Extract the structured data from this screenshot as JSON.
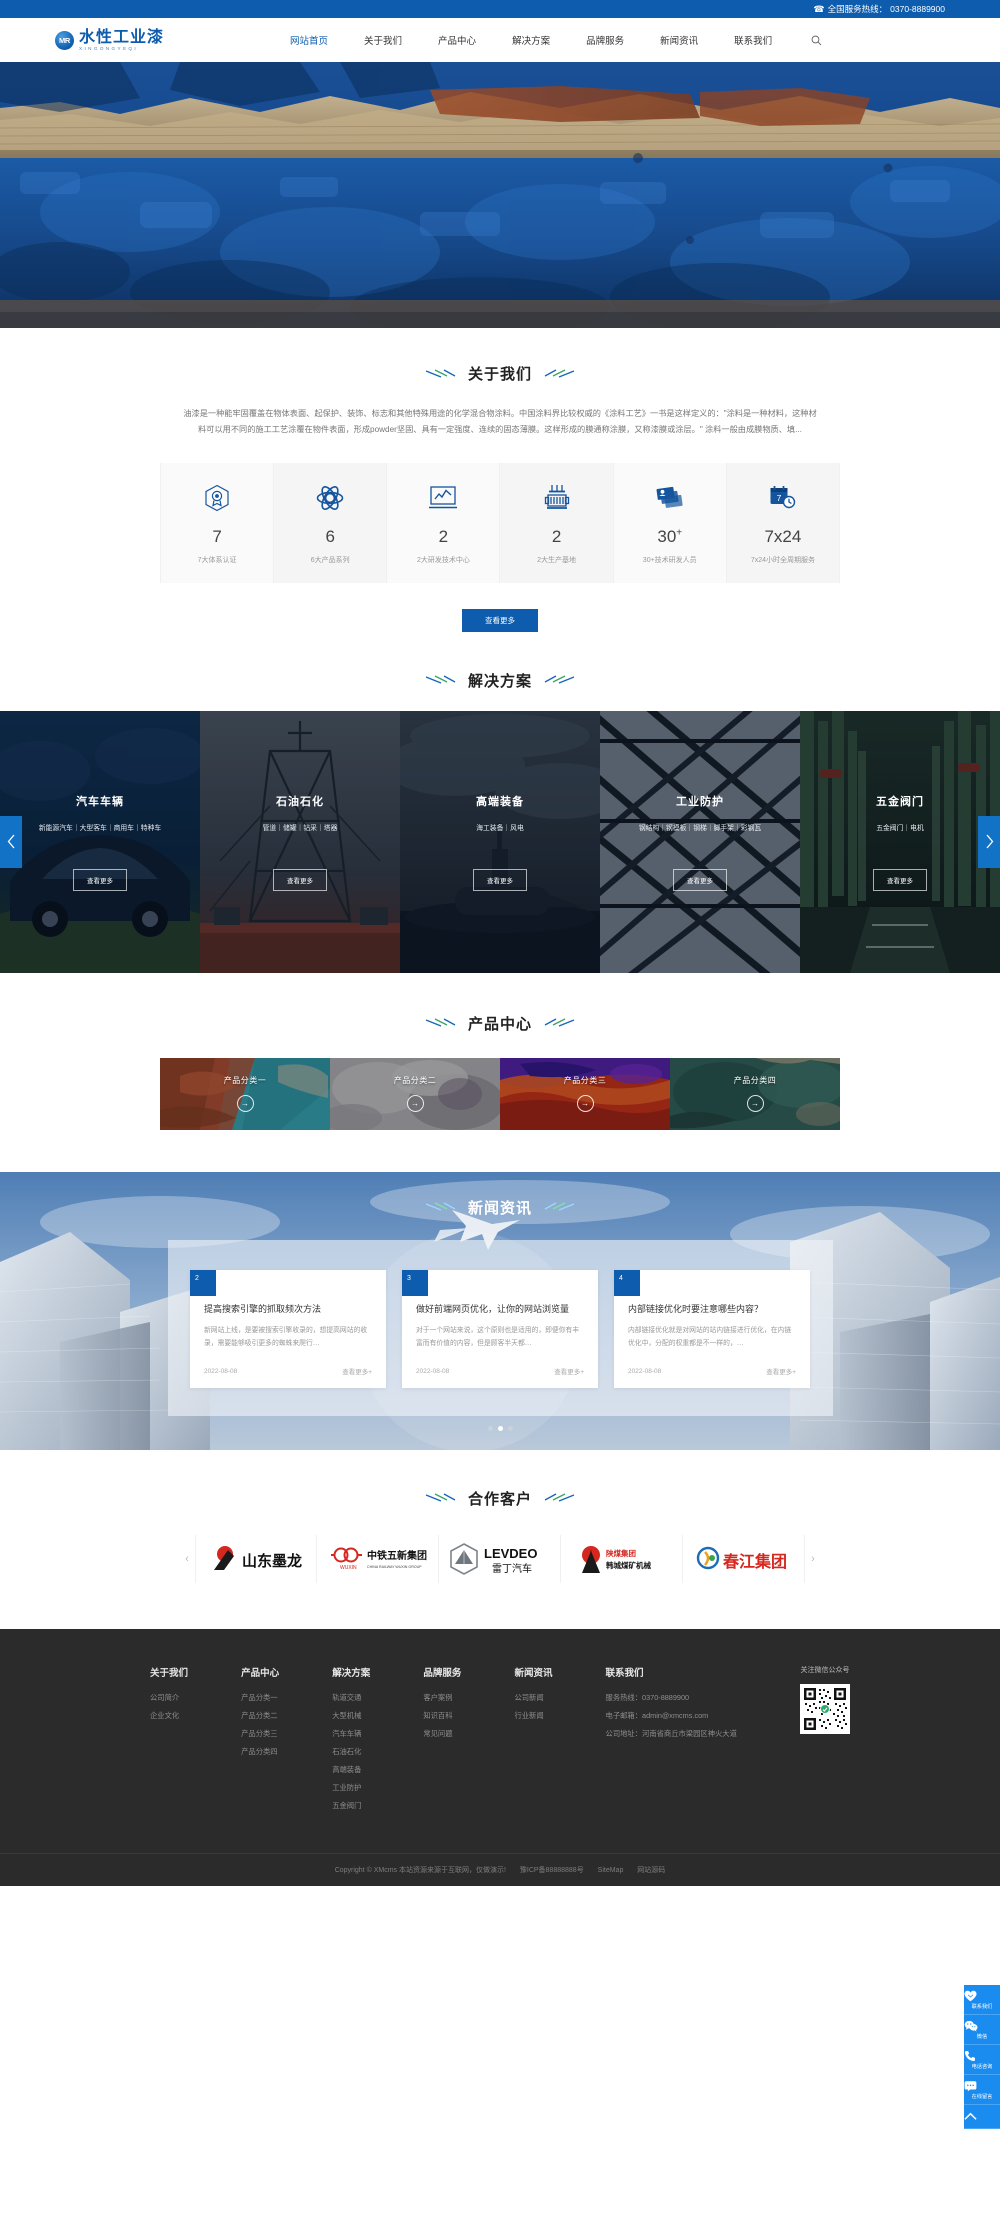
{
  "topbar": {
    "hotline_label": "全国服务热线：",
    "hotline": "0370-8889900",
    "phone_icon": "telephone-icon"
  },
  "header": {
    "logo": {
      "badge": "MR",
      "cn": "水性工业漆",
      "en": "XINGONGYEQI"
    },
    "nav": [
      {
        "label": "网站首页",
        "active": true
      },
      {
        "label": "关于我们",
        "active": false
      },
      {
        "label": "产品中心",
        "active": false
      },
      {
        "label": "解决方案",
        "active": false
      },
      {
        "label": "品牌服务",
        "active": false
      },
      {
        "label": "新闻资讯",
        "active": false
      },
      {
        "label": "联系我们",
        "active": false
      }
    ],
    "search_icon": "search-icon"
  },
  "about": {
    "title": "关于我们",
    "desc": "油漆是一种能牢固覆盖在物体表面、起保护、装饰、标志和其他特殊用途的化学混合物涂料。中国涂料界比较权威的《涂料工艺》一书是这样定义的：\"涂料是一种材料，这种材料可以用不同的施工工艺涂覆在物件表面，形成powder坚固、具有一定强度、连续的固态薄膜。这样形成的膜通称涂膜，又称漆膜或涂层。\" 涂料一般由成膜物质、填...",
    "stats": [
      {
        "icon": "certificate-badge-icon",
        "num": "7",
        "sup": "",
        "label": "7大体系认证"
      },
      {
        "icon": "atom-icon",
        "num": "6",
        "sup": "",
        "label": "6大产品系列"
      },
      {
        "icon": "chart-monitor-icon",
        "num": "2",
        "sup": "",
        "label": "2大研发技术中心"
      },
      {
        "icon": "factory-icon",
        "num": "2",
        "sup": "",
        "label": "2大生产基地"
      },
      {
        "icon": "id-cards-icon",
        "num": "30",
        "sup": "+",
        "label": "30+技术研发人员"
      },
      {
        "icon": "calendar-clock-icon",
        "num": "7x24",
        "sup": "",
        "label": "7x24小时全周期服务"
      }
    ],
    "more_button": "查看更多"
  },
  "solutions": {
    "title": "解决方案",
    "prev_icon": "chevron-left-icon",
    "next_icon": "chevron-right-icon",
    "items": [
      {
        "name": "汽车车辆",
        "tags": "新能源汽车｜大型客车｜商用车｜特种车",
        "button": "查看更多",
        "theme": "car"
      },
      {
        "name": "石油石化",
        "tags": "管道｜储罐｜钻采｜塔器",
        "button": "查看更多",
        "theme": "oil"
      },
      {
        "name": "高端装备",
        "tags": "海工装备｜风电",
        "button": "查看更多",
        "theme": "equip"
      },
      {
        "name": "工业防护",
        "tags": "钢结构｜钢模板｜钢梯｜脚手架｜彩钢瓦",
        "button": "查看更多",
        "theme": "industry"
      },
      {
        "name": "五金阀门",
        "tags": "五金阀门｜电机",
        "button": "查看更多",
        "theme": "valve"
      }
    ]
  },
  "products": {
    "title": "产品中心",
    "items": [
      {
        "name": "产品分类一",
        "arrow_icon": "arrow-right-icon",
        "theme": "p1"
      },
      {
        "name": "产品分类二",
        "arrow_icon": "arrow-right-icon",
        "theme": "p2"
      },
      {
        "name": "产品分类三",
        "arrow_icon": "arrow-right-icon",
        "theme": "p3"
      },
      {
        "name": "产品分类四",
        "arrow_icon": "arrow-right-icon",
        "theme": "p4"
      }
    ]
  },
  "news": {
    "title": "新闻资讯",
    "items": [
      {
        "badge": "2",
        "heading": "提高搜索引擎的抓取频次方法",
        "summary": "新网站上线，是要被搜索引擎收录的，想提高网站的收录，需要能够吸引更多的蜘蛛来爬行…",
        "date": "2022-08-08",
        "more": "查看更多+"
      },
      {
        "badge": "3",
        "heading": "做好前端网页优化，让你的网站浏览量",
        "summary": "对于一个网站来说，这个原则也是适用的，即便你有丰富而有价值的内容，但是顾客半天都…",
        "date": "2022-08-08",
        "more": "查看更多+"
      },
      {
        "badge": "4",
        "heading": "内部链接优化时要注意哪些内容？",
        "summary": "内部链接优化就是对网站的站内链接进行优化，在内链优化中，分配的权重都是不一样的，…",
        "date": "2022-08-08",
        "more": "查看更多+"
      }
    ],
    "dots": [
      false,
      true,
      false
    ]
  },
  "partners": {
    "title": "合作客户",
    "prev_icon": "chevron-left-icon",
    "next_icon": "chevron-right-icon",
    "items": [
      {
        "name": "山东墨龙",
        "theme": "molong"
      },
      {
        "name": "中铁五新集团",
        "theme": "wuxin"
      },
      {
        "name": "LEVDEO 雷丁汽车",
        "theme": "levdeo"
      },
      {
        "name": "陕煤集团 韩城煤矿机械",
        "theme": "shaanmei"
      },
      {
        "name": "春江集团",
        "theme": "chunjiang"
      }
    ]
  },
  "footer": {
    "columns": [
      {
        "title": "关于我们",
        "links": [
          "公司简介",
          "企业文化"
        ]
      },
      {
        "title": "产品中心",
        "links": [
          "产品分类一",
          "产品分类二",
          "产品分类三",
          "产品分类四"
        ]
      },
      {
        "title": "解决方案",
        "links": [
          "轨道交通",
          "大型机械",
          "汽车车辆",
          "石油石化",
          "高端装备",
          "工业防护",
          "五金阀门"
        ]
      },
      {
        "title": "品牌服务",
        "links": [
          "客户案例",
          "知识百科",
          "常见问题"
        ]
      },
      {
        "title": "新闻资讯",
        "links": [
          "公司新闻",
          "行业新闻"
        ]
      },
      {
        "title": "联系我们",
        "links": [
          "服务热线：0370-8889900",
          "电子邮箱：admin@xmcms.com",
          "公司地址：河南省商丘市梁园区神火大道"
        ]
      }
    ],
    "qr": {
      "caption": "关注微信公众号",
      "icon": "qr-code-icon"
    },
    "copyright": {
      "text": "Copyright © XMcms 本站资源来源于互联网，仅做演示!",
      "icp": "豫ICP备88888888号",
      "sitemap": "SiteMap",
      "source": "网站源码"
    }
  },
  "float_bar": [
    {
      "icon": "heart-icon",
      "label": "联系我们"
    },
    {
      "icon": "wechat-icon",
      "label": "微信"
    },
    {
      "icon": "phone-icon",
      "label": "电话咨询"
    },
    {
      "icon": "message-icon",
      "label": "在线留言"
    },
    {
      "icon": "chevron-up-icon",
      "label": ""
    }
  ]
}
